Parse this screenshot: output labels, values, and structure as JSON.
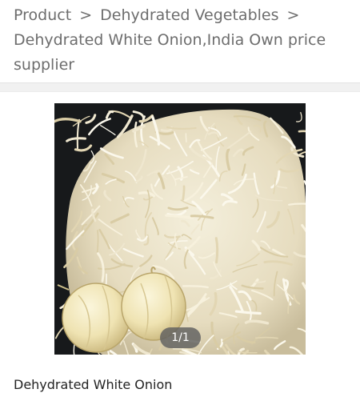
{
  "breadcrumb": {
    "items": [
      {
        "label": "Product"
      },
      {
        "label": "Dehydrated Vegetables"
      },
      {
        "label": "Dehydrated White Onion,India Own price supplier"
      }
    ],
    "separator": ">"
  },
  "gallery": {
    "image_subject": "product-photo",
    "counter": "1/1"
  },
  "product": {
    "name": "Dehydrated White Onion"
  },
  "colors": {
    "text_muted": "#6d6d6d",
    "text_dark": "#222222",
    "divider": "#f1f1f1",
    "photo_background": "#17191b"
  }
}
